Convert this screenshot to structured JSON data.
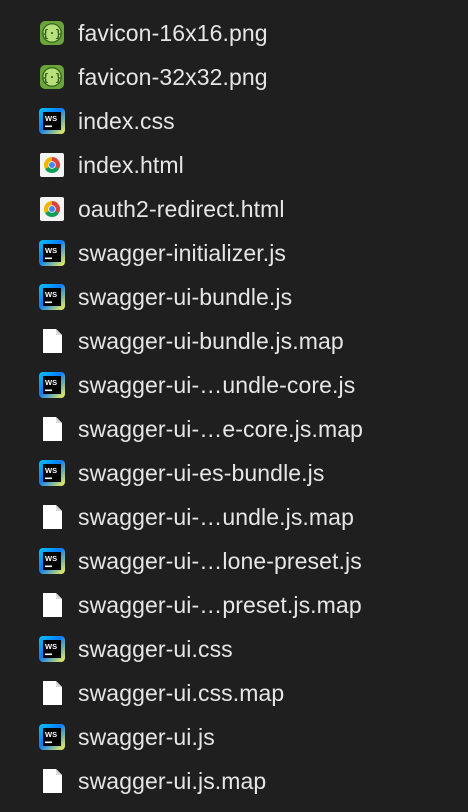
{
  "colors": {
    "background": "#1f1f20",
    "text": "#e6e6e6"
  },
  "files": [
    {
      "name": "favicon-16x16.png",
      "icon": "png-icon"
    },
    {
      "name": "favicon-32x32.png",
      "icon": "png-icon"
    },
    {
      "name": "index.css",
      "icon": "webstorm-icon"
    },
    {
      "name": "index.html",
      "icon": "chrome-icon"
    },
    {
      "name": "oauth2-redirect.html",
      "icon": "chrome-icon"
    },
    {
      "name": "swagger-initializer.js",
      "icon": "webstorm-icon"
    },
    {
      "name": "swagger-ui-bundle.js",
      "icon": "webstorm-icon"
    },
    {
      "name": "swagger-ui-bundle.js.map",
      "icon": "document-icon"
    },
    {
      "name": "swagger-ui-…undle-core.js",
      "icon": "webstorm-icon"
    },
    {
      "name": "swagger-ui-…e-core.js.map",
      "icon": "document-icon"
    },
    {
      "name": "swagger-ui-es-bundle.js",
      "icon": "webstorm-icon"
    },
    {
      "name": "swagger-ui-…undle.js.map",
      "icon": "document-icon"
    },
    {
      "name": "swagger-ui-…lone-preset.js",
      "icon": "webstorm-icon"
    },
    {
      "name": "swagger-ui-…preset.js.map",
      "icon": "document-icon"
    },
    {
      "name": "swagger-ui.css",
      "icon": "webstorm-icon"
    },
    {
      "name": "swagger-ui.css.map",
      "icon": "document-icon"
    },
    {
      "name": "swagger-ui.js",
      "icon": "webstorm-icon"
    },
    {
      "name": "swagger-ui.js.map",
      "icon": "document-icon"
    }
  ]
}
